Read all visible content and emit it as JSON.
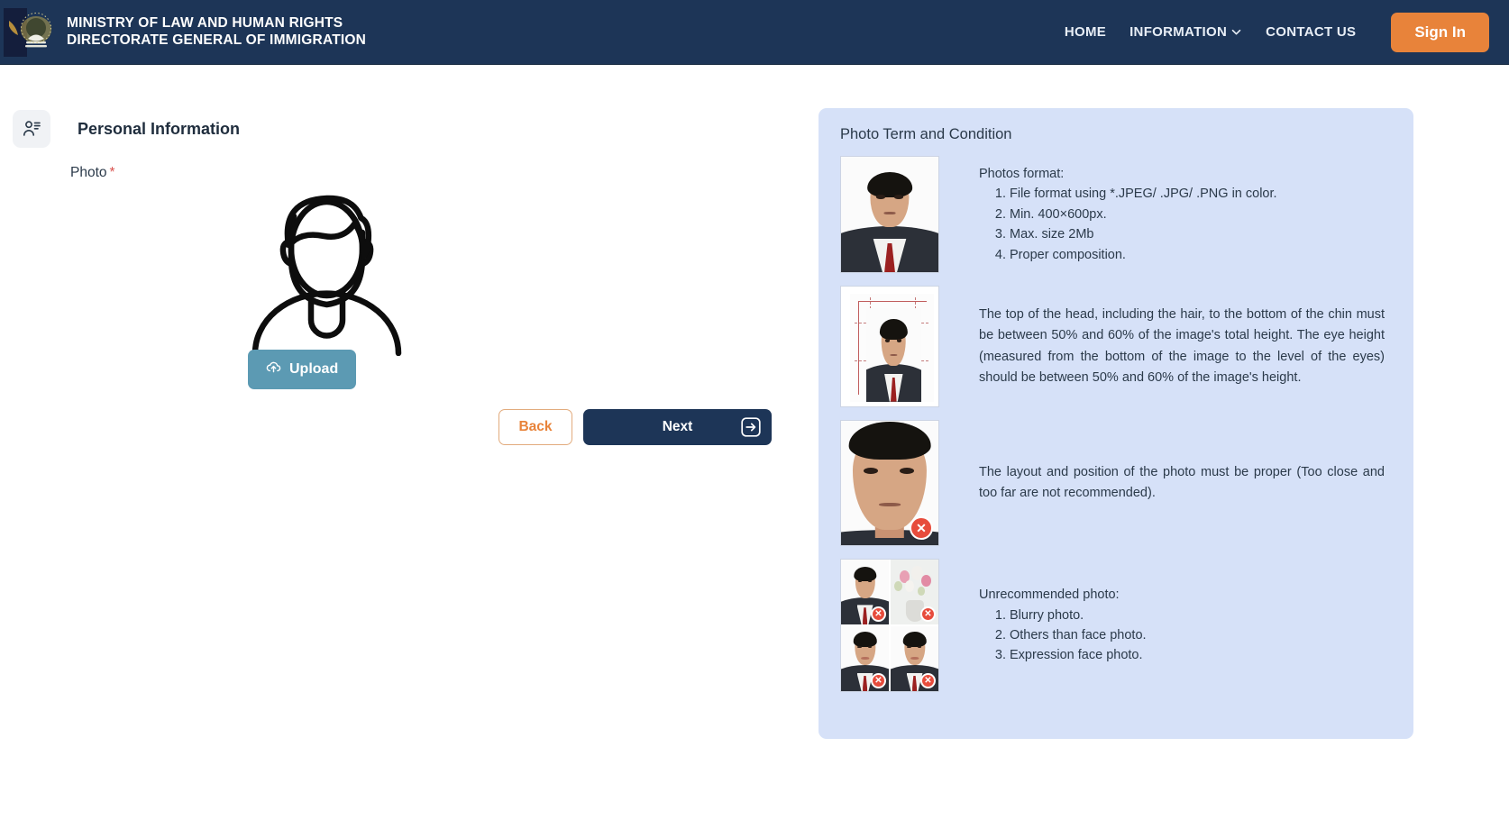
{
  "header": {
    "logo_icon": "national-crest-icon",
    "title_line1": "MINISTRY OF  LAW  AND HUMAN RIGHTS",
    "title_line2": "DIRECTORATE GENERAL OF IMMIGRATION",
    "nav": [
      {
        "label": "HOME",
        "has_dropdown": false
      },
      {
        "label": "INFORMATION",
        "has_dropdown": true
      },
      {
        "label": "CONTACT US",
        "has_dropdown": false
      }
    ],
    "signin_label": "Sign In",
    "bg_color": "#1d3557",
    "signin_color": "#e8833a"
  },
  "form": {
    "section_icon": "user-details-icon",
    "section_title": "Personal Information",
    "photo_label": "Photo",
    "required_mark": "*",
    "avatar_icon": "person-placeholder-icon",
    "upload_label": "Upload",
    "upload_icon": "cloud-upload-icon",
    "upload_color": "#5c9ab3",
    "back_label": "Back",
    "next_label": "Next",
    "next_icon": "arrow-right-box-icon",
    "next_color": "#1d3557",
    "back_border_color": "#e2ab7d"
  },
  "info_panel": {
    "title": "Photo Term and Condition",
    "bg_color": "#d6e1f8",
    "rows": [
      {
        "thumb": "passport-photo-correct",
        "heading": "Photos format:",
        "list": [
          "File format using *.JPEG/ .JPG/ .PNG in color.",
          "Min. 400×600px.",
          "Max. size 2Mb",
          "Proper composition."
        ],
        "paragraph": ""
      },
      {
        "thumb": "passport-photo-measurements",
        "heading": "",
        "list": [],
        "paragraph": "The top of the head, including the hair, to the bottom of the chin must be between 50% and 60% of the image's total height. The eye height (measured from the bottom of the image to the level of the eyes) should be between 50% and 60% of the image's height."
      },
      {
        "thumb": "passport-photo-too-close",
        "heading": "",
        "list": [],
        "paragraph": "The layout and position of the photo must be proper (Too close and too far are not recommended)."
      },
      {
        "thumb": "unrecommended-photo-grid",
        "heading": "Unrecommended photo:",
        "list": [
          "Blurry photo.",
          "Others than face photo.",
          "Expression face photo."
        ],
        "paragraph": ""
      }
    ]
  }
}
